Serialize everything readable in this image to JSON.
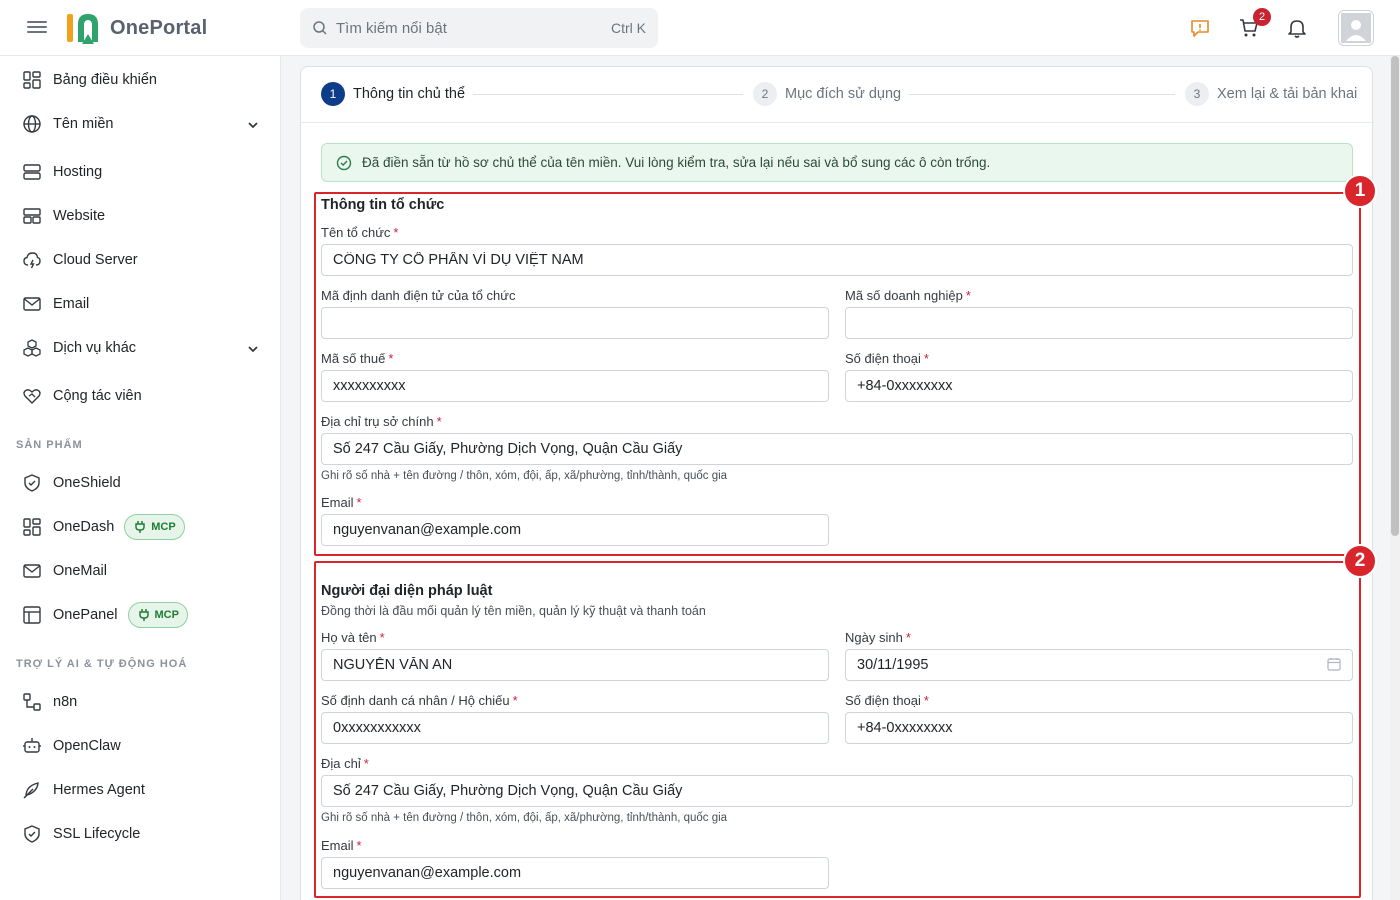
{
  "header": {
    "brand": "OnePortal",
    "search_placeholder": "Tìm kiếm nổi bật",
    "search_shortcut": "Ctrl K",
    "cart_count": "2"
  },
  "sidebar": {
    "items": [
      {
        "label": "Bảng điều khiển",
        "icon": "dashboard-icon"
      },
      {
        "label": "Tên miền",
        "icon": "globe-icon"
      },
      {
        "label": "Hosting",
        "icon": "server-icon"
      },
      {
        "label": "Website",
        "icon": "website-icon"
      },
      {
        "label": "Cloud Server",
        "icon": "cloud-icon"
      },
      {
        "label": "Email",
        "icon": "mail-icon"
      },
      {
        "label": "Dịch vụ khác",
        "icon": "boxes-icon"
      },
      {
        "label": "Cộng tác viên",
        "icon": "handshake-icon"
      }
    ],
    "section_products": "SẢN PHẨM",
    "products": [
      {
        "label": "OneShield",
        "icon": "shield-icon"
      },
      {
        "label": "OneDash",
        "icon": "dashboard-icon",
        "badge": "MCP"
      },
      {
        "label": "OneMail",
        "icon": "mail-icon"
      },
      {
        "label": "OnePanel",
        "icon": "panel-icon",
        "badge": "MCP"
      }
    ],
    "section_ai": "TRỢ LÝ AI & TỰ ĐỘNG HOÁ",
    "ai": [
      {
        "label": "n8n",
        "icon": "workflow-icon"
      },
      {
        "label": "OpenClaw",
        "icon": "robot-icon"
      },
      {
        "label": "Hermes Agent",
        "icon": "feather-icon"
      },
      {
        "label": "SSL Lifecycle",
        "icon": "shield-check-icon"
      }
    ]
  },
  "stepper": {
    "steps": [
      {
        "num": "1",
        "label": "Thông tin chủ thể"
      },
      {
        "num": "2",
        "label": "Mục đích sử dụng"
      },
      {
        "num": "3",
        "label": "Xem lại & tải bản khai"
      }
    ]
  },
  "alert": "Đã điền sẵn từ hồ sơ chủ thể của tên miền. Vui lòng kiểm tra, sửa lại nếu sai và bổ sung các ô còn trống.",
  "org": {
    "badge": "1",
    "title": "Thông tin tổ chức",
    "name_label": "Tên tổ chức",
    "name_value": "CÔNG TY CỔ PHẦN VÍ DỤ VIỆT NAM",
    "eid_label": "Mã định danh điện tử của tổ chức",
    "eid_value": "",
    "bizno_label": "Mã số doanh nghiệp",
    "bizno_value": "",
    "tax_label": "Mã số thuế",
    "tax_value": "xxxxxxxxxx",
    "phone_label": "Số điện thoại",
    "phone_value": "+84-0xxxxxxxx",
    "address_label": "Địa chỉ trụ sở chính",
    "address_value": "Số 247 Cầu Giấy, Phường Dịch Vọng, Quận Cầu Giấy",
    "address_hint": "Ghi rõ số nhà + tên đường / thôn, xóm, đội, ấp, xã/phường, tỉnh/thành, quốc gia",
    "email_label": "Email",
    "email_value": "nguyenvanan@example.com"
  },
  "rep": {
    "badge": "2",
    "title": "Người đại diện pháp luật",
    "subtitle": "Đồng thời là đầu mối quản lý tên miền, quản lý kỹ thuật và thanh toán",
    "name_label": "Họ và tên",
    "name_value": "NGUYỄN VĂN AN",
    "dob_label": "Ngày sinh",
    "dob_value": "30/11/1995",
    "id_label": "Số định danh cá nhân / Hộ chiếu",
    "id_value": "0xxxxxxxxxxx",
    "phone_label": "Số điện thoại",
    "phone_value": "+84-0xxxxxxxx",
    "address_label": "Địa chỉ",
    "address_value": "Số 247 Cầu Giấy, Phường Dịch Vọng, Quận Cầu Giấy",
    "address_hint": "Ghi rõ số nhà + tên đường / thôn, xóm, đội, ấp, xã/phường, tỉnh/thành, quốc gia",
    "email_label": "Email",
    "email_value": "nguyenvanan@example.com"
  },
  "colors": {
    "primary": "#0d3c88",
    "highlight": "#d9262c",
    "required": "#c82333"
  }
}
